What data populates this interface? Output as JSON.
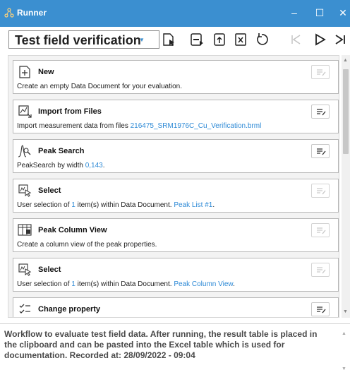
{
  "window": {
    "title": "Runner",
    "app_icon": "runner-nodes-icon",
    "controls": {
      "minimize": "–",
      "maximize": "☐",
      "close": "✕"
    }
  },
  "toolbar": {
    "workflow_name": "Test field verification",
    "dropdown_icon": "chevron-down-icon",
    "icons": [
      "open-cursor-icon",
      "save-run-icon",
      "export-icon",
      "delete-icon",
      "reset-icon",
      "step-back-icon",
      "run-icon",
      "step-forward-icon"
    ],
    "accent_color": "#3b8fd0"
  },
  "steps": [
    {
      "title": "New",
      "desc": [
        {
          "t": "Create an empty Data Document for your evaluation."
        }
      ],
      "icon": "new-document-icon",
      "edit_enabled": false
    },
    {
      "title": "Import from Files",
      "desc": [
        {
          "t": "Import measurement data from files "
        },
        {
          "t": "216475_SRM1976C_Cu_Verification.brml",
          "link": true
        }
      ],
      "icon": "import-chart-icon",
      "edit_enabled": true
    },
    {
      "title": "Peak Search",
      "desc": [
        {
          "t": "PeakSearch by width "
        },
        {
          "t": "0,143",
          "link": true
        },
        {
          "t": "."
        }
      ],
      "icon": "peak-search-icon",
      "edit_enabled": true
    },
    {
      "title": "Select",
      "desc": [
        {
          "t": "User selection of "
        },
        {
          "t": "1",
          "link": true
        },
        {
          "t": " item(s) within Data Document. "
        },
        {
          "t": "Peak List #1",
          "link": true
        },
        {
          "t": "."
        }
      ],
      "icon": "select-cursor-icon",
      "edit_enabled": false
    },
    {
      "title": "Peak Column View",
      "desc": [
        {
          "t": "Create a column view of the peak properties."
        }
      ],
      "icon": "column-view-icon",
      "edit_enabled": false
    },
    {
      "title": "Select",
      "desc": [
        {
          "t": "User selection of "
        },
        {
          "t": "1",
          "link": true
        },
        {
          "t": " item(s) within Data Document. "
        },
        {
          "t": "Peak Column View",
          "link": true
        },
        {
          "t": "."
        }
      ],
      "icon": "select-cursor-icon",
      "edit_enabled": false
    },
    {
      "title": "Change property",
      "desc": [],
      "icon": "change-property-icon",
      "edit_enabled": true
    }
  ],
  "description": "Workflow to evaluate test field data. After running, the result table is placed in the clipboard and can be pasted into the Excel table which is used for documentation. Recorded at: 28/09/2022 - 09:04"
}
